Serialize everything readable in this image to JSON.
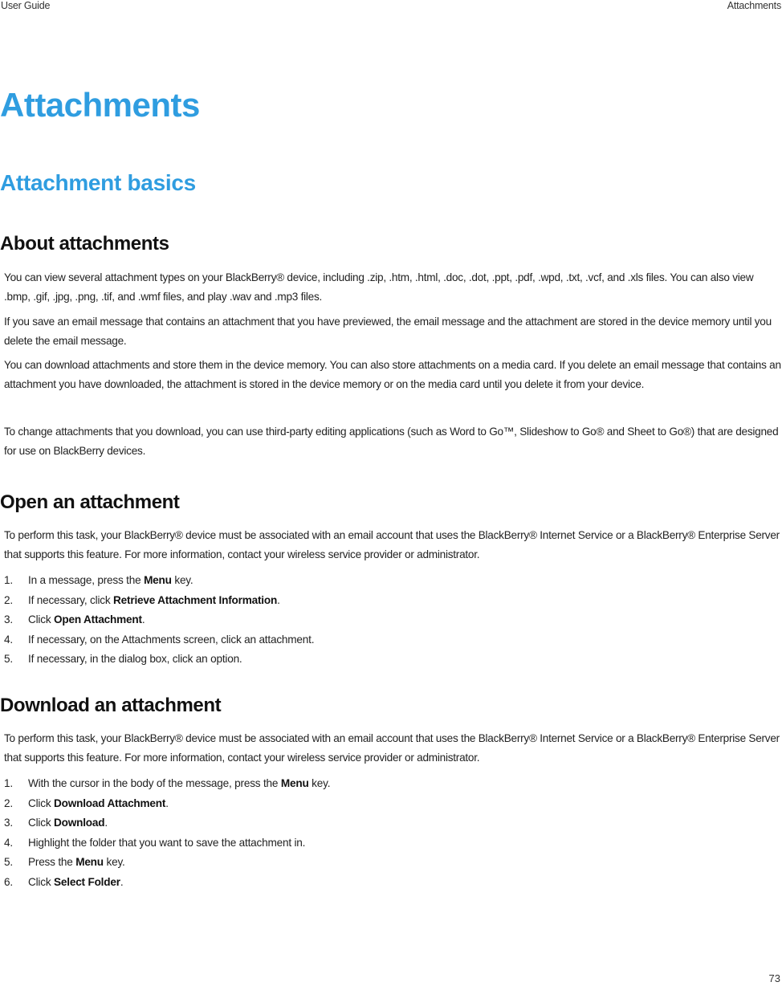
{
  "header": {
    "left": "User Guide",
    "right": "Attachments"
  },
  "chapter_title": "Attachments",
  "section_title": "Attachment basics",
  "about": {
    "title": "About attachments",
    "paragraphs": [
      "You can view several attachment types on your BlackBerry® device, including .zip, .htm, .html, .doc, .dot, .ppt, .pdf, .wpd, .txt, .vcf, and .xls files. You can also view .bmp, .gif, .jpg, .png, .tif, and .wmf files, and play .wav and .mp3 files.",
      "If you save an email message that contains an attachment that you have previewed, the email message and the attachment are stored in the device memory until you delete the email message.",
      "You can download attachments and store them in the device memory. You can also store attachments on a media card. If you delete an email message that contains an attachment you have downloaded, the attachment is stored in the device memory or on the media card until you delete it from your device.",
      "To change attachments that you download, you can use third-party editing applications (such as Word to Go™, Slideshow to Go® and Sheet to Go®) that are designed for use on BlackBerry devices."
    ]
  },
  "open": {
    "title": "Open an attachment",
    "intro": "To perform this task, your BlackBerry® device must be associated with an email account that uses the BlackBerry® Internet Service or a BlackBerry® Enterprise Server that supports this feature. For more information, contact your wireless service provider or administrator.",
    "steps": [
      {
        "num": "1.",
        "before": "In a message, press the ",
        "bold": "Menu",
        "after": " key."
      },
      {
        "num": "2.",
        "before": "If necessary, click ",
        "bold": "Retrieve Attachment Information",
        "after": "."
      },
      {
        "num": "3.",
        "before": "Click ",
        "bold": "Open Attachment",
        "after": "."
      },
      {
        "num": "4.",
        "before": "If necessary, on the Attachments screen, click an attachment.",
        "bold": "",
        "after": ""
      },
      {
        "num": "5.",
        "before": "If necessary, in the dialog box, click an option.",
        "bold": "",
        "after": ""
      }
    ]
  },
  "download": {
    "title": "Download an attachment",
    "intro": "To perform this task, your BlackBerry® device must be associated with an email account that uses the BlackBerry® Internet Service or a BlackBerry® Enterprise Server that supports this feature. For more information, contact your wireless service provider or administrator.",
    "steps": [
      {
        "num": "1.",
        "before": "With the cursor in the body of the message, press the ",
        "bold": "Menu",
        "after": " key."
      },
      {
        "num": "2.",
        "before": "Click ",
        "bold": "Download Attachment",
        "after": "."
      },
      {
        "num": "3.",
        "before": "Click ",
        "bold": "Download",
        "after": "."
      },
      {
        "num": "4.",
        "before": "Highlight the folder that you want to save the attachment in.",
        "bold": "",
        "after": ""
      },
      {
        "num": "5.",
        "before": "Press the ",
        "bold": "Menu",
        "after": " key."
      },
      {
        "num": "6.",
        "before": "Click ",
        "bold": "Select Folder",
        "after": "."
      }
    ]
  },
  "page_number": "73"
}
